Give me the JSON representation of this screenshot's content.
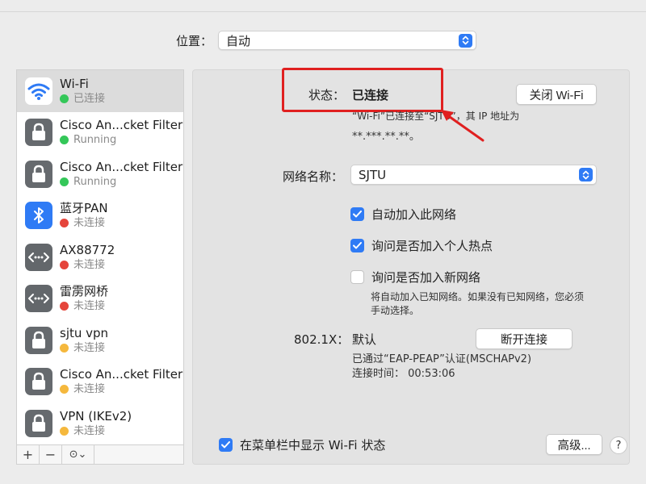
{
  "location": {
    "label": "位置：",
    "value": "自动"
  },
  "services": [
    {
      "name": "Wi-Fi",
      "status": "已连接",
      "dot": "#34c759",
      "icon": "wifi-icon",
      "selected": true
    },
    {
      "name": "Cisco An...cket Filter",
      "status": "Running",
      "dot": "#34c759",
      "icon": "lock-icon"
    },
    {
      "name": "Cisco An...cket Filter",
      "status": "Running",
      "dot": "#34c759",
      "icon": "lock-icon"
    },
    {
      "name": "蓝牙PAN",
      "status": "未连接",
      "dot": "#e5453b",
      "icon": "bluetooth-icon"
    },
    {
      "name": "AX88772",
      "status": "未连接",
      "dot": "#e5453b",
      "icon": "ethernet-icon"
    },
    {
      "name": "雷雳网桥",
      "status": "未连接",
      "dot": "#e5453b",
      "icon": "ethernet-icon"
    },
    {
      "name": "sjtu vpn",
      "status": "未连接",
      "dot": "#f5b83d",
      "icon": "lock-icon"
    },
    {
      "name": "Cisco An...cket Filter",
      "status": "未连接",
      "dot": "#f5b83d",
      "icon": "lock-icon"
    },
    {
      "name": "VPN (IKEv2)",
      "status": "未连接",
      "dot": "#f5b83d",
      "icon": "lock-icon"
    }
  ],
  "toolbar": {
    "add": "+",
    "remove": "−",
    "more": "⊙⌄"
  },
  "status": {
    "label": "状态：",
    "value": "已连接",
    "button": "关闭 Wi-Fi",
    "detail_line1": "“Wi-Fi”已连接至“SJTU”，其 IP 地址为",
    "detail_line2": "**.***.**.**。"
  },
  "network_name": {
    "label": "网络名称：",
    "value": "SJTU"
  },
  "options": [
    {
      "label": "自动加入此网络",
      "checked": true
    },
    {
      "label": "询问是否加入个人热点",
      "checked": true
    },
    {
      "label": "询问是否加入新网络",
      "checked": false
    }
  ],
  "options_note_line1": "将自动加入已知网络。如果没有已知网络，您必须",
  "options_note_line2": "手动选择。",
  "dot1x": {
    "label": "802.1X：",
    "value": "默认",
    "button": "断开连接",
    "detail_line1": "已通过“EAP-PEAP”认证(MSCHAPv2)",
    "detail_line2": "连接时间： 00:53:06"
  },
  "menubar_checkbox": {
    "label": "在菜单栏中显示 Wi-Fi 状态",
    "checked": true
  },
  "advanced_button": "高级...",
  "help_button": "?",
  "colors": {
    "accent": "#2f7bf5",
    "highlight": "#e02020"
  }
}
